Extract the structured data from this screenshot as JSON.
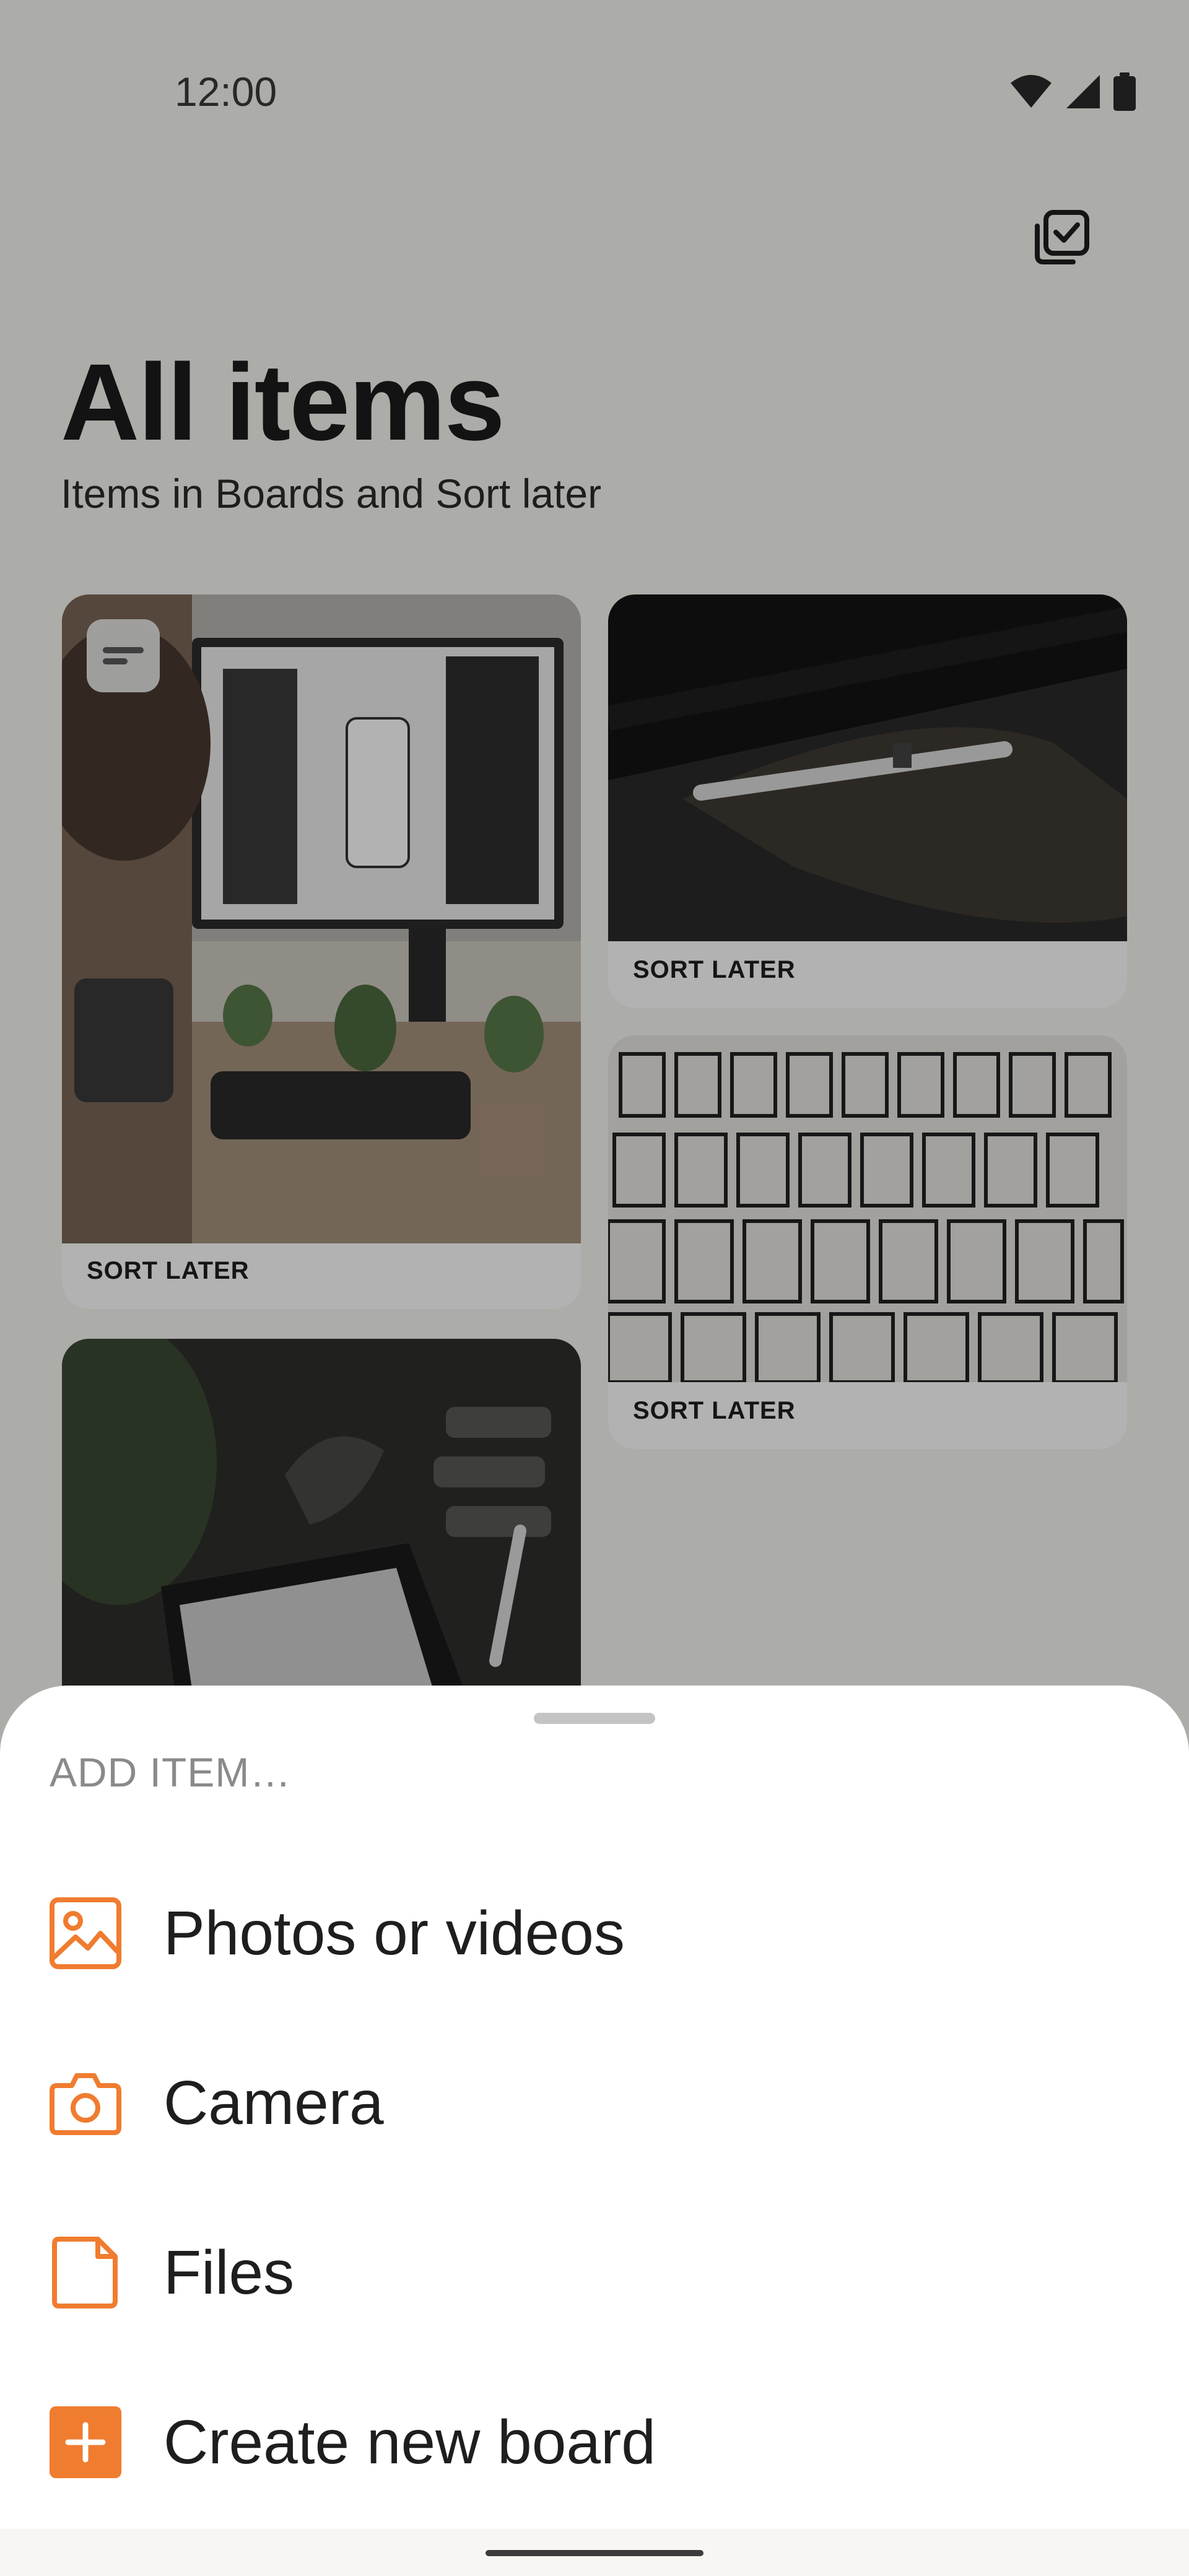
{
  "status_bar": {
    "time": "12:00",
    "icons": [
      "wifi-icon",
      "signal-icon",
      "battery-icon"
    ]
  },
  "header": {
    "select_icon": "multi-select-icon",
    "title": "All items",
    "subtitle": "Items in Boards and Sort later"
  },
  "items": [
    {
      "label": "SORT LATER",
      "description": "Designer working at desk with monitor",
      "has_note_badge": true
    },
    {
      "label": "SORT LATER",
      "description": "Stylus pen on tablet"
    },
    {
      "label": "SORT LATER",
      "description": "Paper wireframe sketches"
    },
    {
      "label": "",
      "description": "Person drawing on tablet with stylus"
    }
  ],
  "sheet": {
    "title": "ADD ITEM…",
    "options": [
      {
        "label": "Photos or videos",
        "icon": "image-icon"
      },
      {
        "label": "Camera",
        "icon": "camera-icon"
      },
      {
        "label": "Files",
        "icon": "file-icon"
      },
      {
        "label": "Create new board",
        "icon": "add-board-icon"
      }
    ]
  },
  "colors": {
    "accent": "#f07c2f",
    "background": "#f7f6f3",
    "sheet": "#ffffff"
  }
}
